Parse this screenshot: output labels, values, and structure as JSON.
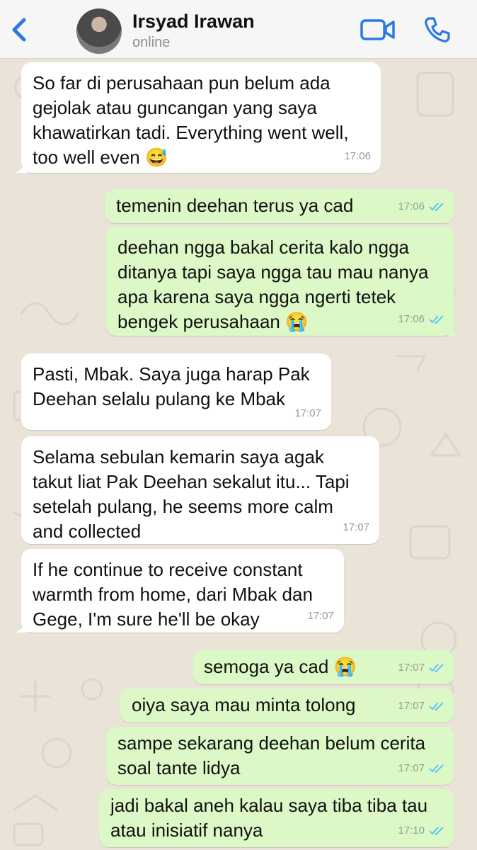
{
  "header": {
    "contact_name": "Irsyad Irawan",
    "status": "online"
  },
  "messages": [
    {
      "dir": "in",
      "text": "So far di perusahaan pun belum ada\ngejolak atau guncangan yang saya\nkhawatirkan tadi. Everything went well,\ntoo well even 😅",
      "time": "17:06"
    },
    {
      "dir": "out",
      "text": "temenin deehan terus ya cad",
      "time": "17:06"
    },
    {
      "dir": "out",
      "text": "deehan ngga bakal cerita kalo ngga\nditanya tapi saya ngga tau mau nanya\napa karena saya ngga ngerti tetek\nbengek perusahaan 😭",
      "time": "17:06"
    },
    {
      "dir": "in",
      "text": "Pasti, Mbak. Saya juga harap Pak\nDeehan selalu pulang ke Mbak",
      "time": "17:07"
    },
    {
      "dir": "in",
      "text": "Selama sebulan kemarin saya agak\ntakut liat Pak Deehan sekalut itu... Tapi\nsetelah pulang, he seems more calm\nand collected",
      "time": "17:07"
    },
    {
      "dir": "in",
      "text": "If he continue to receive constant\nwarmth from home, dari Mbak dan\nGege, I'm sure he'll be okay",
      "time": "17:07"
    },
    {
      "dir": "out",
      "text": "semoga ya cad 😭",
      "time": "17:07"
    },
    {
      "dir": "out",
      "text": "oiya saya mau minta tolong",
      "time": "17:07"
    },
    {
      "dir": "out",
      "text": "sampe sekarang deehan belum cerita\nsoal tante lidya",
      "time": "17:07"
    },
    {
      "dir": "out",
      "text": "jadi bakal aneh kalau saya tiba tiba tau\natau inisiatif nanya",
      "time": "17:10"
    }
  ]
}
